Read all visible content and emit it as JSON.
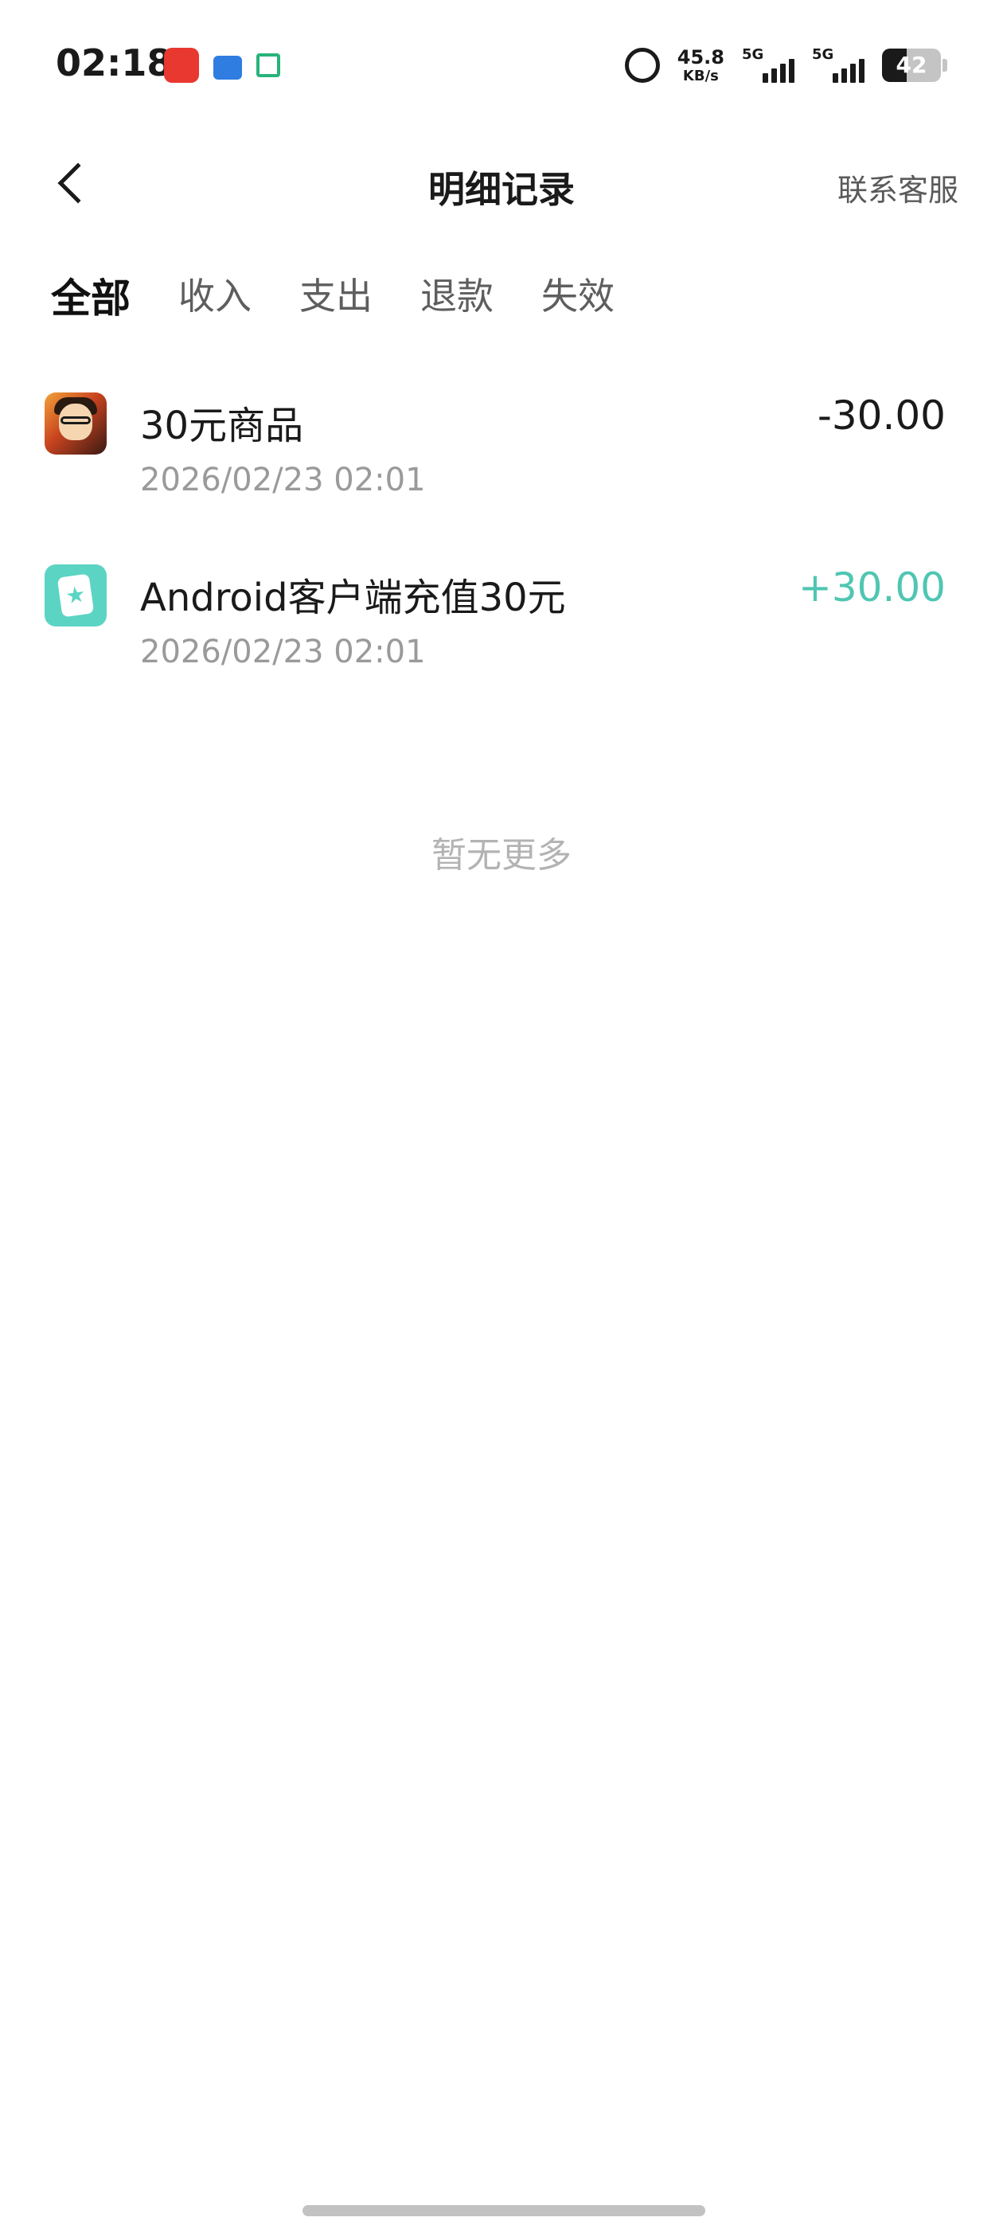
{
  "status_bar": {
    "time": "02:18",
    "net_speed_value": "45.8",
    "net_speed_unit": "KB/s",
    "signal1_label": "5G",
    "signal2_label": "5G",
    "battery_level": "42",
    "icons": [
      "alarm-icon",
      "signal-icon",
      "battery-icon"
    ]
  },
  "header": {
    "title": "明细记录",
    "service_label": "联系客服"
  },
  "tabs": [
    {
      "label": "全部",
      "active": true
    },
    {
      "label": "收入",
      "active": false
    },
    {
      "label": "支出",
      "active": false
    },
    {
      "label": "退款",
      "active": false
    },
    {
      "label": "失效",
      "active": false
    }
  ],
  "records": [
    {
      "title": "30元商品",
      "time": "2026/02/23 02:01",
      "amount": "-30.00",
      "type": "expense"
    },
    {
      "title": "Android客户端充值30元",
      "time": "2026/02/23 02:01",
      "amount": "+30.00",
      "type": "income"
    }
  ],
  "footer_text": "暂无更多",
  "colors": {
    "accent": "#47cbb8",
    "income": "#4fc6b2",
    "text_primary": "#1a1a1a",
    "text_secondary": "#9a9a9a"
  }
}
